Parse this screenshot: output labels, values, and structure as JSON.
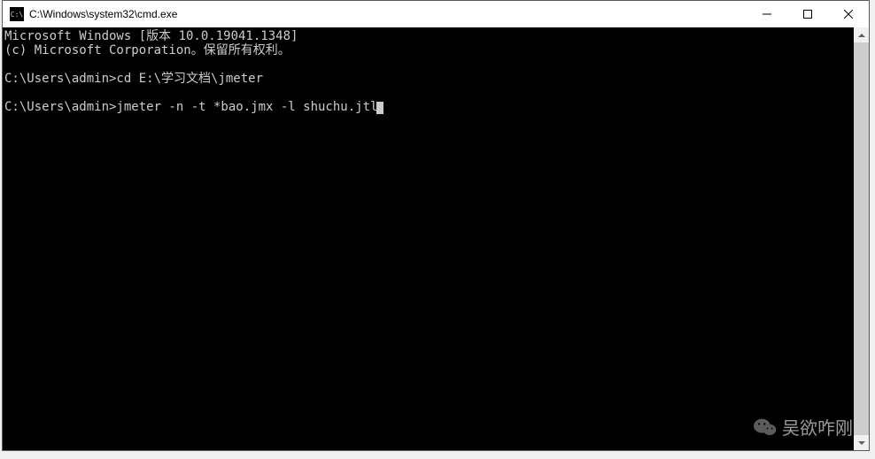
{
  "window": {
    "title": "C:\\Windows\\system32\\cmd.exe",
    "icon_label": "C:\\"
  },
  "terminal": {
    "lines": [
      "Microsoft Windows [版本 10.0.19041.1348]",
      "(c) Microsoft Corporation。保留所有权利。",
      "",
      "C:\\Users\\admin>cd E:\\学习文档\\jmeter",
      "",
      "C:\\Users\\admin>jmeter -n -t *bao.jmx -l shuchu.jtl"
    ]
  },
  "watermark": {
    "text": "吴欲咋刚"
  }
}
